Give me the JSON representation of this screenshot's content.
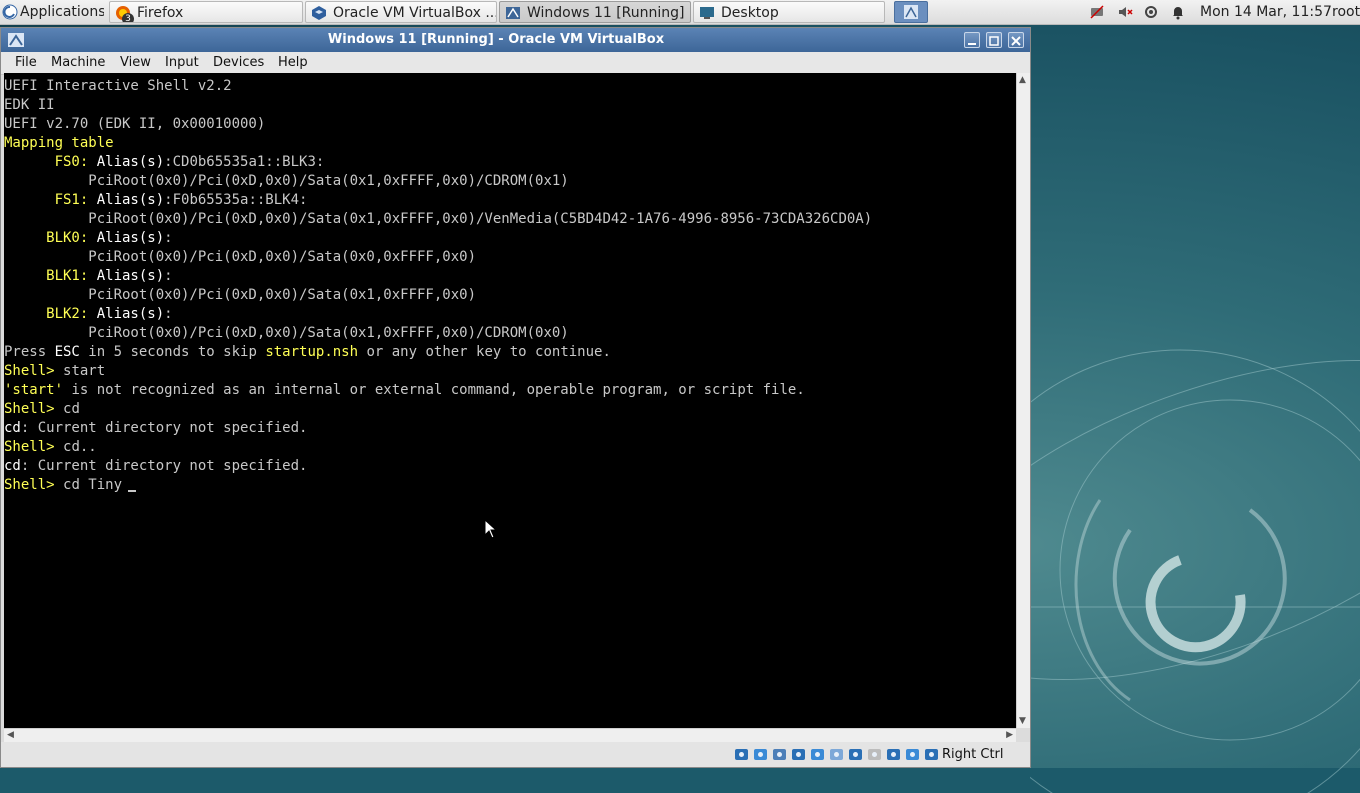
{
  "top_panel": {
    "applications_label": "Applications",
    "tasks": [
      {
        "label": "Firefox",
        "icon": "firefox-icon",
        "badge": "3"
      },
      {
        "label": "Oracle VM VirtualBox ...",
        "icon": "virtualbox-icon"
      },
      {
        "label": "Windows 11 [Running] ...",
        "icon": "vm-window-icon"
      },
      {
        "label": "Desktop",
        "icon": "desktop-icon"
      }
    ],
    "clock": "Mon 14 Mar, 11:57",
    "user": "root"
  },
  "window": {
    "title": "Windows 11 [Running] - Oracle VM VirtualBox",
    "menu": [
      "File",
      "Machine",
      "View",
      "Input",
      "Devices",
      "Help"
    ]
  },
  "console": {
    "lines": [
      [
        {
          "t": "UEFI Interactive Shell v2.2",
          "c": "g"
        }
      ],
      [
        {
          "t": "EDK II",
          "c": "g"
        }
      ],
      [
        {
          "t": "UEFI v2.70 (EDK II, 0x00010000)",
          "c": "g"
        }
      ],
      [
        {
          "t": "Mapping table",
          "c": "y"
        }
      ],
      [
        {
          "t": "      FS0: ",
          "c": "y"
        },
        {
          "t": "Alias(s)",
          "c": "w"
        },
        {
          "t": ":CD0b65535a1::BLK3:",
          "c": "g"
        }
      ],
      [
        {
          "t": "          PciRoot(0x0)/Pci(0xD,0x0)/Sata(0x1,0xFFFF,0x0)/CDROM(0x1)",
          "c": "g"
        }
      ],
      [
        {
          "t": "      FS1: ",
          "c": "y"
        },
        {
          "t": "Alias(s)",
          "c": "w"
        },
        {
          "t": ":F0b65535a::BLK4:",
          "c": "g"
        }
      ],
      [
        {
          "t": "          PciRoot(0x0)/Pci(0xD,0x0)/Sata(0x1,0xFFFF,0x0)/VenMedia(C5BD4D42-1A76-4996-8956-73CDA326CD0A)",
          "c": "g"
        }
      ],
      [
        {
          "t": "     BLK0: ",
          "c": "y"
        },
        {
          "t": "Alias(s)",
          "c": "w"
        },
        {
          "t": ":",
          "c": "g"
        }
      ],
      [
        {
          "t": "          PciRoot(0x0)/Pci(0xD,0x0)/Sata(0x0,0xFFFF,0x0)",
          "c": "g"
        }
      ],
      [
        {
          "t": "     BLK1: ",
          "c": "y"
        },
        {
          "t": "Alias(s)",
          "c": "w"
        },
        {
          "t": ":",
          "c": "g"
        }
      ],
      [
        {
          "t": "          PciRoot(0x0)/Pci(0xD,0x0)/Sata(0x1,0xFFFF,0x0)",
          "c": "g"
        }
      ],
      [
        {
          "t": "     BLK2: ",
          "c": "y"
        },
        {
          "t": "Alias(s)",
          "c": "w"
        },
        {
          "t": ":",
          "c": "g"
        }
      ],
      [
        {
          "t": "          PciRoot(0x0)/Pci(0xD,0x0)/Sata(0x1,0xFFFF,0x0)/CDROM(0x0)",
          "c": "g"
        }
      ],
      [
        {
          "t": "Press ",
          "c": "g"
        },
        {
          "t": "ESC",
          "c": "w"
        },
        {
          "t": " in 5 seconds to skip ",
          "c": "g"
        },
        {
          "t": "startup.nsh",
          "c": "y"
        },
        {
          "t": " or any other key to continue.",
          "c": "g"
        }
      ],
      [
        {
          "t": "Shell> ",
          "c": "y"
        },
        {
          "t": "start",
          "c": "g"
        }
      ],
      [
        {
          "t": "'start'",
          "c": "y"
        },
        {
          "t": " is not recognized as an internal or external command, operable program, or script file.",
          "c": "g"
        }
      ],
      [
        {
          "t": "Shell> ",
          "c": "y"
        },
        {
          "t": "cd",
          "c": "g"
        }
      ],
      [
        {
          "t": "cd",
          "c": "w"
        },
        {
          "t": ": Current directory not specified.",
          "c": "g"
        }
      ],
      [
        {
          "t": "Shell> ",
          "c": "y"
        },
        {
          "t": "cd..",
          "c": "g"
        }
      ],
      [
        {
          "t": "cd",
          "c": "w"
        },
        {
          "t": ": Current directory not specified.",
          "c": "g"
        }
      ],
      [
        {
          "t": "Shell> ",
          "c": "y"
        },
        {
          "t": "cd Tiny",
          "c": "g"
        }
      ]
    ]
  },
  "statusbar": {
    "host_key": "Right Ctrl",
    "icons": [
      "hard-disk-icon",
      "optical-drive-icon",
      "audio-icon",
      "network-icon",
      "usb-icon",
      "shared-folder-icon",
      "display-icon",
      "recording-icon",
      "cpu-icon",
      "mouse-integration-icon",
      "keyboard-capture-icon"
    ]
  },
  "colors": {
    "titlebar": "#3d6698",
    "console_bg": "#000000",
    "console_yellow": "#ffff55",
    "desktop": "#1b5363"
  }
}
